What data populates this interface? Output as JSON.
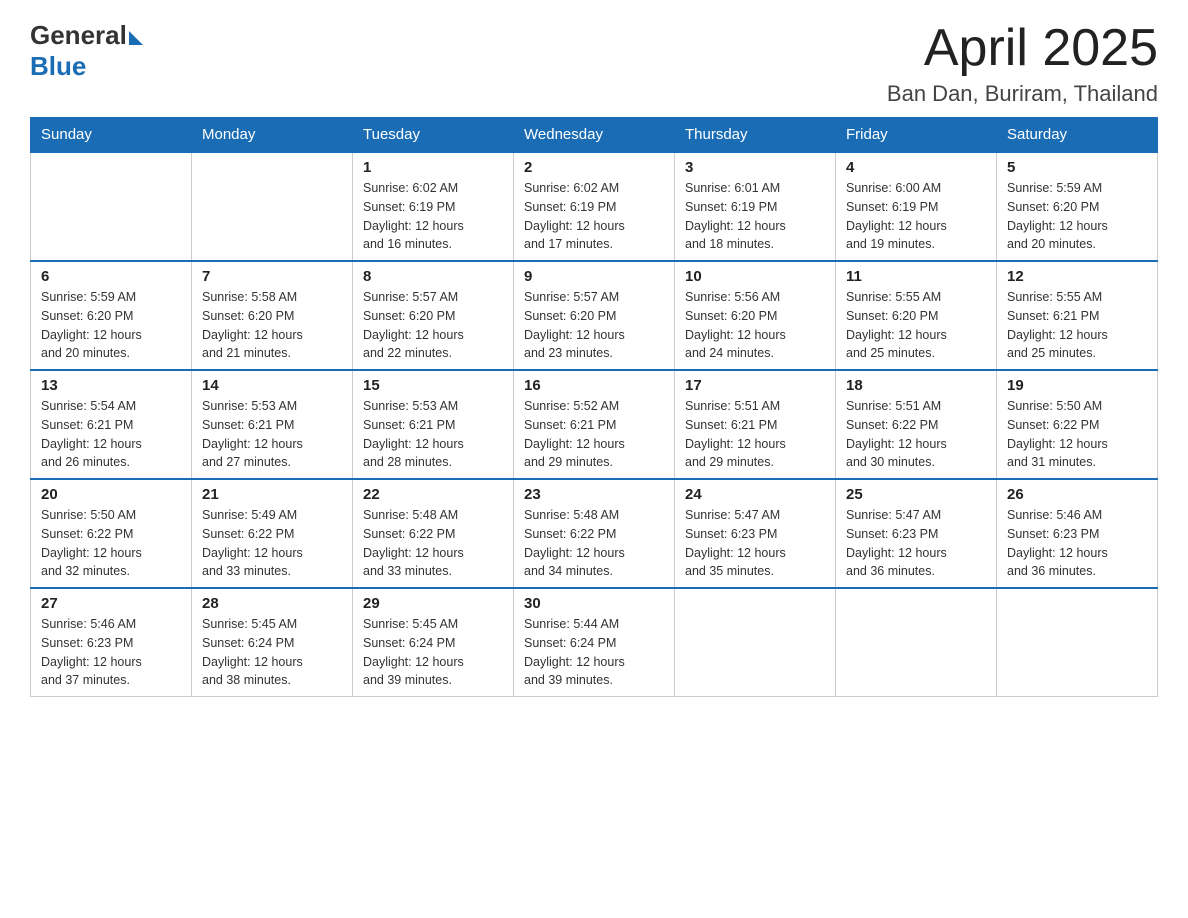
{
  "header": {
    "title": "April 2025",
    "subtitle": "Ban Dan, Buriram, Thailand",
    "logo": {
      "general": "General",
      "blue": "Blue"
    }
  },
  "days_of_week": [
    "Sunday",
    "Monday",
    "Tuesday",
    "Wednesday",
    "Thursday",
    "Friday",
    "Saturday"
  ],
  "weeks": [
    [
      {
        "day": "",
        "info": ""
      },
      {
        "day": "",
        "info": ""
      },
      {
        "day": "1",
        "info": "Sunrise: 6:02 AM\nSunset: 6:19 PM\nDaylight: 12 hours\nand 16 minutes."
      },
      {
        "day": "2",
        "info": "Sunrise: 6:02 AM\nSunset: 6:19 PM\nDaylight: 12 hours\nand 17 minutes."
      },
      {
        "day": "3",
        "info": "Sunrise: 6:01 AM\nSunset: 6:19 PM\nDaylight: 12 hours\nand 18 minutes."
      },
      {
        "day": "4",
        "info": "Sunrise: 6:00 AM\nSunset: 6:19 PM\nDaylight: 12 hours\nand 19 minutes."
      },
      {
        "day": "5",
        "info": "Sunrise: 5:59 AM\nSunset: 6:20 PM\nDaylight: 12 hours\nand 20 minutes."
      }
    ],
    [
      {
        "day": "6",
        "info": "Sunrise: 5:59 AM\nSunset: 6:20 PM\nDaylight: 12 hours\nand 20 minutes."
      },
      {
        "day": "7",
        "info": "Sunrise: 5:58 AM\nSunset: 6:20 PM\nDaylight: 12 hours\nand 21 minutes."
      },
      {
        "day": "8",
        "info": "Sunrise: 5:57 AM\nSunset: 6:20 PM\nDaylight: 12 hours\nand 22 minutes."
      },
      {
        "day": "9",
        "info": "Sunrise: 5:57 AM\nSunset: 6:20 PM\nDaylight: 12 hours\nand 23 minutes."
      },
      {
        "day": "10",
        "info": "Sunrise: 5:56 AM\nSunset: 6:20 PM\nDaylight: 12 hours\nand 24 minutes."
      },
      {
        "day": "11",
        "info": "Sunrise: 5:55 AM\nSunset: 6:20 PM\nDaylight: 12 hours\nand 25 minutes."
      },
      {
        "day": "12",
        "info": "Sunrise: 5:55 AM\nSunset: 6:21 PM\nDaylight: 12 hours\nand 25 minutes."
      }
    ],
    [
      {
        "day": "13",
        "info": "Sunrise: 5:54 AM\nSunset: 6:21 PM\nDaylight: 12 hours\nand 26 minutes."
      },
      {
        "day": "14",
        "info": "Sunrise: 5:53 AM\nSunset: 6:21 PM\nDaylight: 12 hours\nand 27 minutes."
      },
      {
        "day": "15",
        "info": "Sunrise: 5:53 AM\nSunset: 6:21 PM\nDaylight: 12 hours\nand 28 minutes."
      },
      {
        "day": "16",
        "info": "Sunrise: 5:52 AM\nSunset: 6:21 PM\nDaylight: 12 hours\nand 29 minutes."
      },
      {
        "day": "17",
        "info": "Sunrise: 5:51 AM\nSunset: 6:21 PM\nDaylight: 12 hours\nand 29 minutes."
      },
      {
        "day": "18",
        "info": "Sunrise: 5:51 AM\nSunset: 6:22 PM\nDaylight: 12 hours\nand 30 minutes."
      },
      {
        "day": "19",
        "info": "Sunrise: 5:50 AM\nSunset: 6:22 PM\nDaylight: 12 hours\nand 31 minutes."
      }
    ],
    [
      {
        "day": "20",
        "info": "Sunrise: 5:50 AM\nSunset: 6:22 PM\nDaylight: 12 hours\nand 32 minutes."
      },
      {
        "day": "21",
        "info": "Sunrise: 5:49 AM\nSunset: 6:22 PM\nDaylight: 12 hours\nand 33 minutes."
      },
      {
        "day": "22",
        "info": "Sunrise: 5:48 AM\nSunset: 6:22 PM\nDaylight: 12 hours\nand 33 minutes."
      },
      {
        "day": "23",
        "info": "Sunrise: 5:48 AM\nSunset: 6:22 PM\nDaylight: 12 hours\nand 34 minutes."
      },
      {
        "day": "24",
        "info": "Sunrise: 5:47 AM\nSunset: 6:23 PM\nDaylight: 12 hours\nand 35 minutes."
      },
      {
        "day": "25",
        "info": "Sunrise: 5:47 AM\nSunset: 6:23 PM\nDaylight: 12 hours\nand 36 minutes."
      },
      {
        "day": "26",
        "info": "Sunrise: 5:46 AM\nSunset: 6:23 PM\nDaylight: 12 hours\nand 36 minutes."
      }
    ],
    [
      {
        "day": "27",
        "info": "Sunrise: 5:46 AM\nSunset: 6:23 PM\nDaylight: 12 hours\nand 37 minutes."
      },
      {
        "day": "28",
        "info": "Sunrise: 5:45 AM\nSunset: 6:24 PM\nDaylight: 12 hours\nand 38 minutes."
      },
      {
        "day": "29",
        "info": "Sunrise: 5:45 AM\nSunset: 6:24 PM\nDaylight: 12 hours\nand 39 minutes."
      },
      {
        "day": "30",
        "info": "Sunrise: 5:44 AM\nSunset: 6:24 PM\nDaylight: 12 hours\nand 39 minutes."
      },
      {
        "day": "",
        "info": ""
      },
      {
        "day": "",
        "info": ""
      },
      {
        "day": "",
        "info": ""
      }
    ]
  ]
}
